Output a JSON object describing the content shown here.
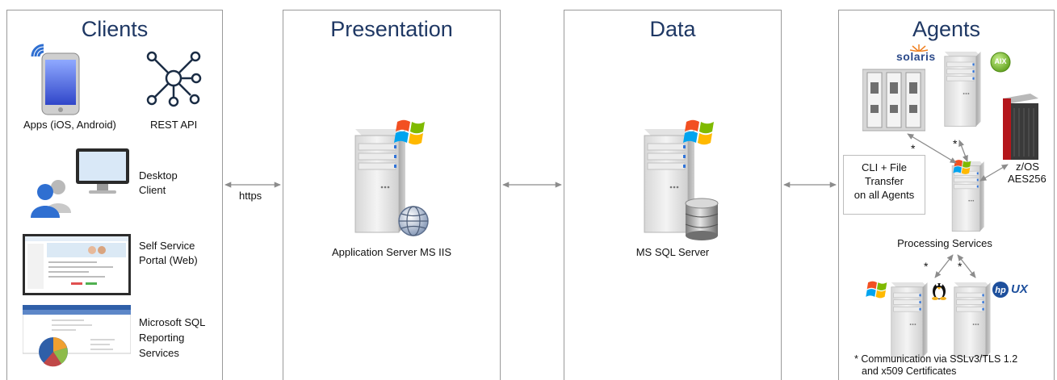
{
  "panels": {
    "clients": {
      "title": "Clients",
      "items": {
        "apps": "Apps (iOS, Android)",
        "rest": "REST API",
        "desktop": [
          "Desktop",
          "Client"
        ],
        "portal": [
          "Self Service",
          "Portal  (Web)"
        ],
        "reporting": [
          "Microsoft SQL",
          "Reporting",
          "Services"
        ]
      }
    },
    "presentation": {
      "title": "Presentation",
      "server_label": "Application Server MS IIS"
    },
    "data": {
      "title": "Data",
      "server_label": "MS SQL Server"
    },
    "agents": {
      "title": "Agents",
      "solaris": "solaris",
      "aix": "AIX",
      "zos": "z/OS",
      "aes": "AES256",
      "cli_box": [
        "CLI + File",
        "Transfer",
        "on all Agents"
      ],
      "processing": "Processing Services",
      "hpux": "UX",
      "star": "*",
      "footnote": [
        "* Communication via SSLv3/TLS 1.2",
        "and x509 Certificates"
      ]
    }
  },
  "connections": {
    "https_label": "https"
  },
  "colors": {
    "title": "#1f3864",
    "border": "#9a9a9a",
    "arrow": "#8c8c8c",
    "windows_red": "#f25022",
    "windows_green": "#7fba00",
    "windows_blue": "#00a4ef",
    "windows_yellow": "#ffb900"
  },
  "icons": [
    "smartphone-wifi-icon",
    "rest-api-network-icon",
    "users-icon",
    "monitor-icon",
    "web-portal-screenshot",
    "reporting-dashboard-screenshot",
    "server-icon",
    "windows-logo-icon",
    "globe-icon",
    "database-icon",
    "blade-server-icon",
    "mainframe-icon",
    "aix-logo-icon",
    "linux-penguin-icon",
    "hp-logo-icon"
  ]
}
